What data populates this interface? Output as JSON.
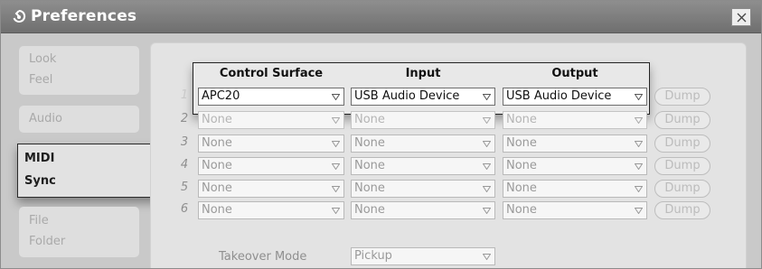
{
  "window": {
    "title": "Preferences"
  },
  "sidebar": {
    "items": [
      {
        "label": "Look"
      },
      {
        "label": "Feel"
      },
      {
        "label": "Audio"
      },
      {
        "label": "MIDI"
      },
      {
        "label": "Sync"
      },
      {
        "label": "File"
      },
      {
        "label": "Folder"
      }
    ]
  },
  "midi_table": {
    "headers": {
      "control_surface": "Control Surface",
      "input": "Input",
      "output": "Output"
    },
    "rows": [
      {
        "num": "1",
        "surface": "APC20",
        "input": "USB Audio Device",
        "output": "USB Audio Device",
        "dump": "Dump"
      },
      {
        "num": "2",
        "surface": "None",
        "input": "None",
        "output": "None",
        "dump": "Dump"
      },
      {
        "num": "3",
        "surface": "None",
        "input": "None",
        "output": "None",
        "dump": "Dump"
      },
      {
        "num": "4",
        "surface": "None",
        "input": "None",
        "output": "None",
        "dump": "Dump"
      },
      {
        "num": "5",
        "surface": "None",
        "input": "None",
        "output": "None",
        "dump": "Dump"
      },
      {
        "num": "6",
        "surface": "None",
        "input": "None",
        "output": "None",
        "dump": "Dump"
      }
    ]
  },
  "takeover": {
    "label": "Takeover Mode",
    "value": "Pickup"
  },
  "icons": {
    "title": "preferences-icon",
    "close": "close-icon",
    "dropdown": "chevron-down-icon"
  }
}
